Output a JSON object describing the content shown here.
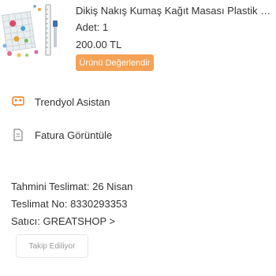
{
  "product": {
    "title": "Dikiş Nakış Kumaş Kağıt Masası Plastik Kl...",
    "quantity": "Adet: 1",
    "price": "200.00 TL",
    "review_label": "Ürünü Değerlendir"
  },
  "actions": {
    "assistant_label": "Trendyol Asistan",
    "invoice_label": "Fatura Görüntüle"
  },
  "shipping": {
    "estimated_key": "Tahmini Teslimat:",
    "estimated_value": "26 Nisan",
    "delivery_no_key": "Teslimat No:",
    "delivery_no_value": "8330293353",
    "seller_key": "Satıcı:",
    "seller_value": "GREATSHOP",
    "seller_chevron": ">"
  },
  "follow": {
    "label": "Takip Ediliyor"
  },
  "colors": {
    "accent": "#f4a255",
    "text": "#333333",
    "muted": "#999999"
  },
  "icons": {
    "assistant": "chat-robot-icon",
    "invoice": "document-icon"
  }
}
